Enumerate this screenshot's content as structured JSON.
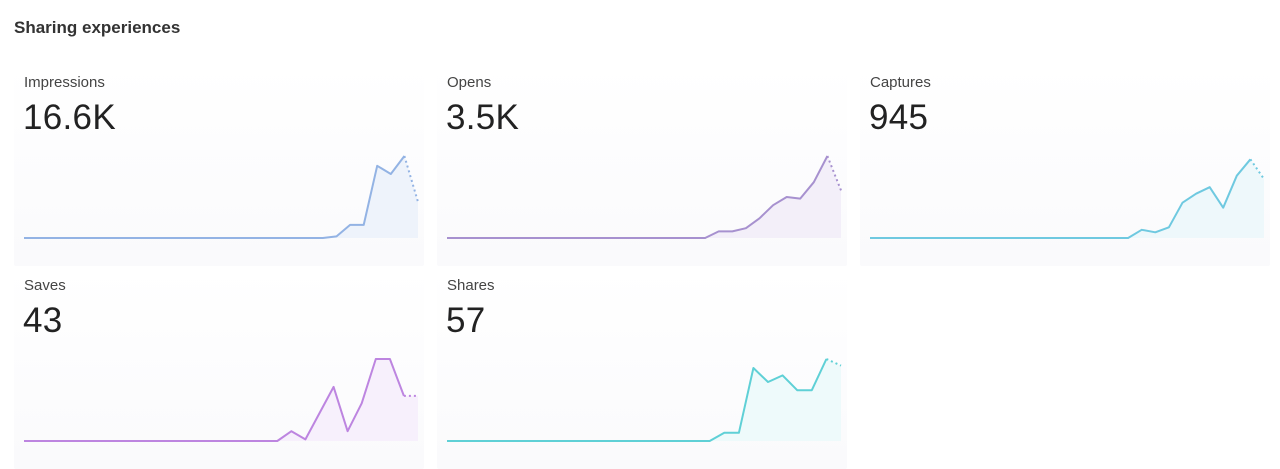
{
  "section": {
    "title": "Sharing experiences"
  },
  "metrics": [
    {
      "key": "impressions",
      "label": "Impressions",
      "value": "16.6K",
      "color": "#93b3e4",
      "fill": "#eef3fb",
      "chart_data": {
        "type": "line",
        "values": [
          0,
          0,
          0,
          0,
          0,
          0,
          0,
          0,
          0,
          0,
          0,
          0,
          0,
          0,
          0,
          0,
          0,
          0,
          0,
          0,
          0,
          0,
          0,
          0.02,
          0.16,
          0.16,
          0.88,
          0.78,
          1.0
        ],
        "projected": [
          1.0,
          0.44
        ],
        "ylim": [
          0,
          1
        ]
      }
    },
    {
      "key": "opens",
      "label": "Opens",
      "value": "3.5K",
      "color": "#a791cf",
      "fill": "#f3eff9",
      "chart_data": {
        "type": "line",
        "values": [
          0,
          0,
          0,
          0,
          0,
          0,
          0,
          0,
          0,
          0,
          0,
          0,
          0,
          0,
          0,
          0,
          0,
          0,
          0,
          0,
          0.08,
          0.08,
          0.12,
          0.24,
          0.4,
          0.5,
          0.48,
          0.68,
          1.0
        ],
        "projected": [
          1.0,
          0.58
        ],
        "ylim": [
          0,
          1
        ]
      }
    },
    {
      "key": "captures",
      "label": "Captures",
      "value": "945",
      "color": "#6fc9e0",
      "fill": "#eef8fb",
      "chart_data": {
        "type": "line",
        "values": [
          0,
          0,
          0,
          0,
          0,
          0,
          0,
          0,
          0,
          0,
          0,
          0,
          0,
          0,
          0,
          0,
          0,
          0,
          0,
          0,
          0.1,
          0.07,
          0.13,
          0.43,
          0.54,
          0.62,
          0.37,
          0.76,
          0.96
        ],
        "projected": [
          0.96,
          0.72
        ],
        "ylim": [
          0,
          1
        ]
      }
    },
    {
      "key": "saves",
      "label": "Saves",
      "value": "43",
      "color": "#bd85e0",
      "fill": "#f7f0fc",
      "chart_data": {
        "type": "line",
        "values": [
          0,
          0,
          0,
          0,
          0,
          0,
          0,
          0,
          0,
          0,
          0,
          0,
          0,
          0,
          0,
          0,
          0,
          0,
          0,
          0.12,
          0.02,
          0.34,
          0.66,
          0.12,
          0.46,
          1.0,
          1.0,
          0.55
        ],
        "projected": [
          0.55,
          0.55
        ],
        "ylim": [
          0,
          1
        ]
      }
    },
    {
      "key": "shares",
      "label": "Shares",
      "value": "57",
      "color": "#5fd0d6",
      "fill": "#eefafb",
      "chart_data": {
        "type": "line",
        "values": [
          0,
          0,
          0,
          0,
          0,
          0,
          0,
          0,
          0,
          0,
          0,
          0,
          0,
          0,
          0,
          0,
          0,
          0,
          0,
          0.1,
          0.1,
          0.89,
          0.72,
          0.8,
          0.62,
          0.62,
          1.0
        ],
        "projected": [
          1.0,
          0.92
        ],
        "ylim": [
          0,
          1
        ]
      }
    }
  ]
}
